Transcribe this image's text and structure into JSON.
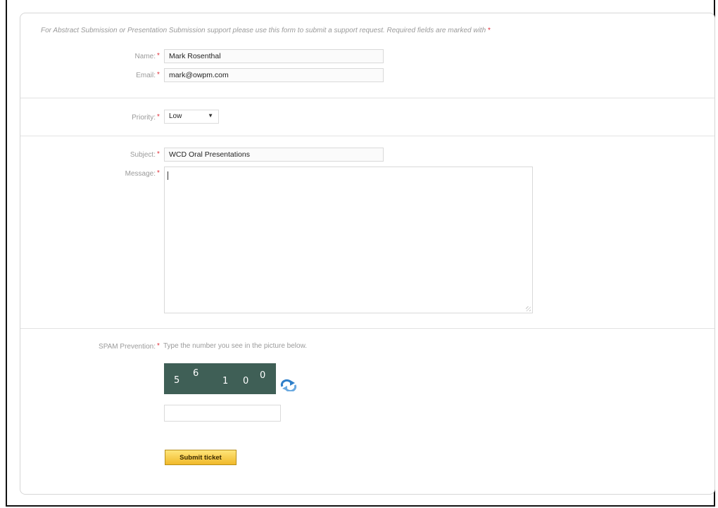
{
  "form": {
    "intro_text": "For Abstract Submission or Presentation Submission support please use this form to submit a support request. Required fields are marked with",
    "required_marker": "*",
    "name": {
      "label": "Name:",
      "value": "Mark Rosenthal"
    },
    "email": {
      "label": "Email:",
      "value": "mark@owpm.com"
    },
    "priority": {
      "label": "Priority:",
      "value": "Low"
    },
    "subject": {
      "label": "Subject:",
      "value": "WCD Oral Presentations"
    },
    "message": {
      "label": "Message:",
      "value": ""
    },
    "spam": {
      "label": "SPAM Prevention:",
      "instruction": "Type the number you see in the picture below.",
      "captcha_chars": [
        "5",
        "6",
        "1",
        "0",
        "0"
      ],
      "answer": ""
    },
    "submit_label": "Submit ticket"
  },
  "colors": {
    "required": "#e0303a",
    "captcha_bg": "#3f5f56",
    "button_top": "#ffe57a",
    "button_bottom": "#f0b92a",
    "label_text": "#9a9a9a"
  },
  "icons": {
    "refresh": "refresh-icon",
    "select_arrow": "chevron-down-icon"
  }
}
